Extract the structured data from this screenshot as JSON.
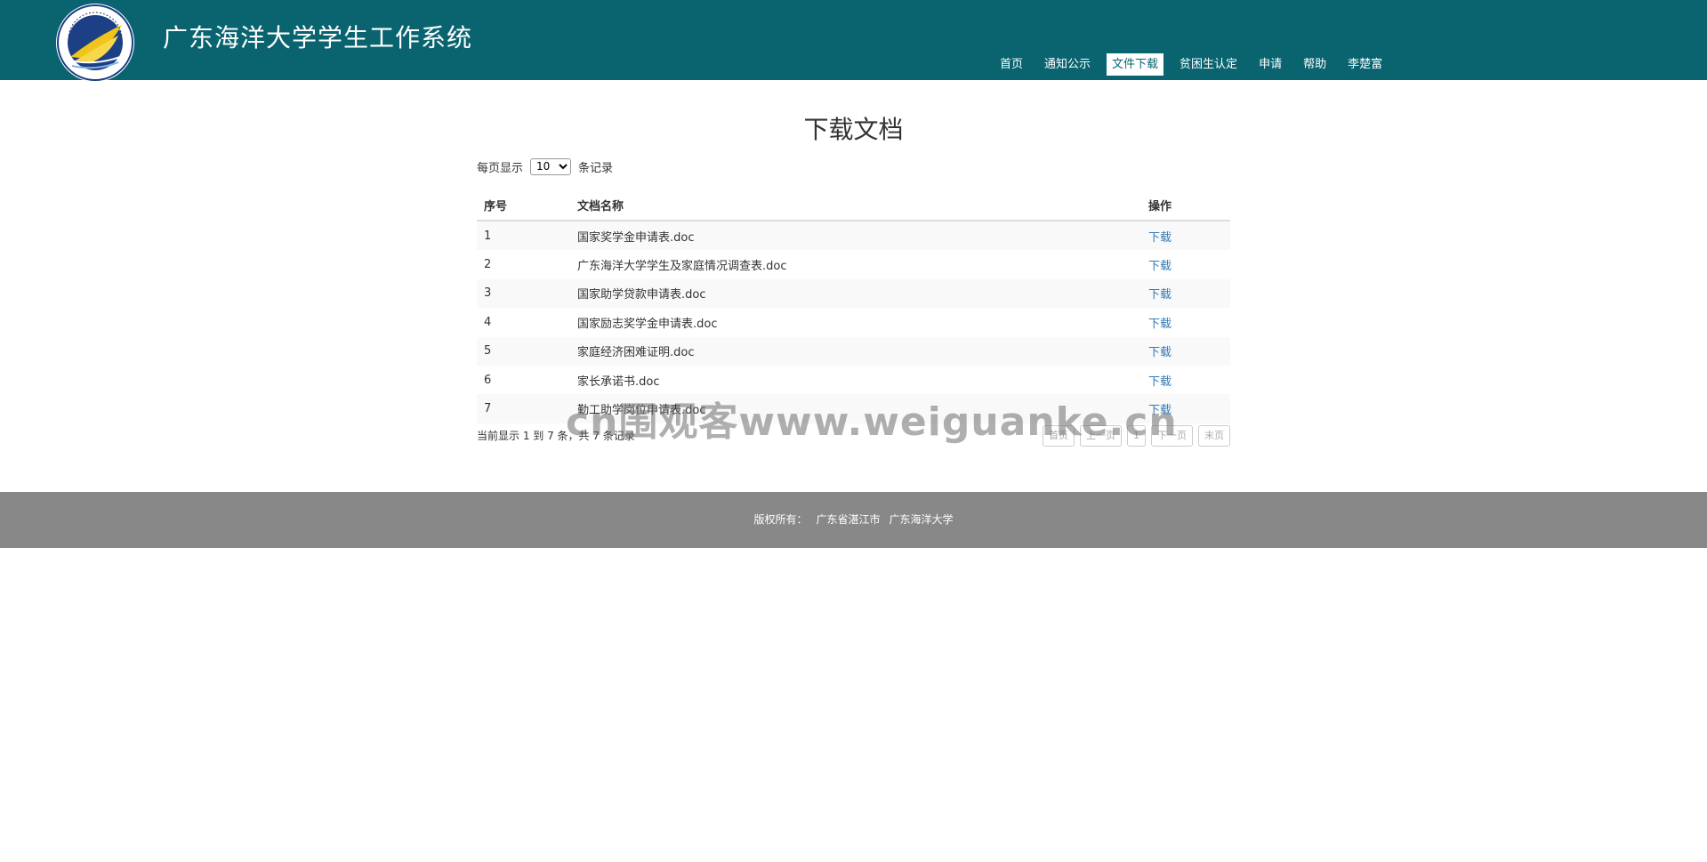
{
  "header": {
    "title": "广东海洋大学学生工作系统",
    "logo_text": "广东海洋大学 GUANGDONG OCEAN UNIVERSITY 1935",
    "bg_color": "#0a6470"
  },
  "nav": {
    "items": [
      {
        "label": "首页",
        "active": false
      },
      {
        "label": "通知公示",
        "active": false
      },
      {
        "label": "文件下载",
        "active": true
      },
      {
        "label": "贫困生认定",
        "active": false
      },
      {
        "label": "申请",
        "active": false
      },
      {
        "label": "帮助",
        "active": false
      },
      {
        "label": "李楚富",
        "active": false
      }
    ]
  },
  "page": {
    "heading": "下载文档",
    "length_prefix": "每页显示",
    "length_value": "10",
    "length_suffix": "条记录"
  },
  "table": {
    "headers": {
      "index": "序号",
      "name": "文档名称",
      "action": "操作"
    },
    "rows": [
      {
        "index": "1",
        "name": "国家奖学金申请表.doc",
        "action": "下载"
      },
      {
        "index": "2",
        "name": "广东海洋大学学生及家庭情况调查表.doc",
        "action": "下载"
      },
      {
        "index": "3",
        "name": "国家助学贷款申请表.doc",
        "action": "下载"
      },
      {
        "index": "4",
        "name": "国家励志奖学金申请表.doc",
        "action": "下载"
      },
      {
        "index": "5",
        "name": "家庭经济困难证明.doc",
        "action": "下载"
      },
      {
        "index": "6",
        "name": "家长承诺书.doc",
        "action": "下载"
      },
      {
        "index": "7",
        "name": "勤工助学岗位申请表.doc",
        "action": "下载"
      }
    ]
  },
  "pagination": {
    "info": "当前显示 1 到 7 条，共 7 条记录",
    "first": "首页",
    "prev": "上一页",
    "current": "1",
    "next": "下一页",
    "last": "末页"
  },
  "watermark": "cn围观客www.weiguanke.cn",
  "footer": {
    "label": "版权所有：",
    "location": "广东省湛江市",
    "school": "广东海洋大学"
  }
}
